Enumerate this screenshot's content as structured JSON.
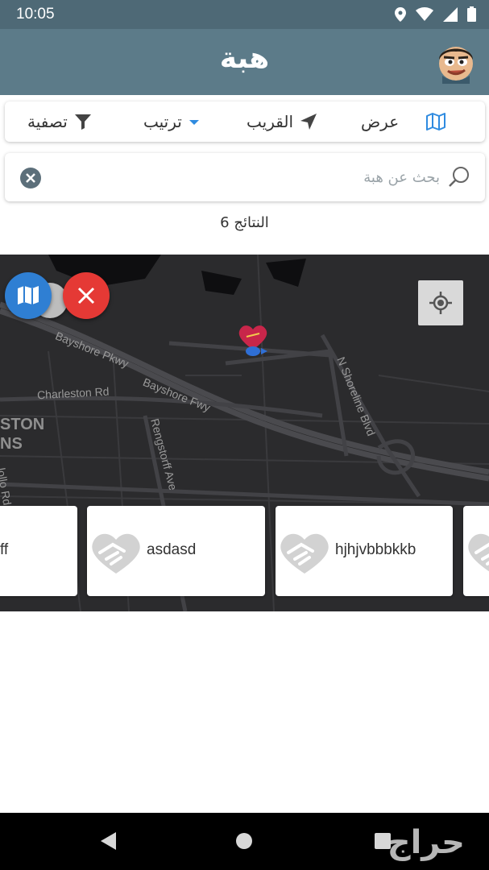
{
  "status_bar": {
    "time": "10:05",
    "icons": [
      "location-icon",
      "wifi-icon",
      "signal-icon",
      "battery-icon"
    ]
  },
  "app_bar": {
    "title": "هبة",
    "avatar": "avatar"
  },
  "toolbar": {
    "map_icon": "map-icon",
    "display_label": "عرض",
    "nearby_label": "القريب",
    "sort_label": "ترتيب",
    "filter_label": "تصفية"
  },
  "search": {
    "placeholder": "بحث عن هبة",
    "value": ""
  },
  "results": {
    "count_text": "النتائج 6"
  },
  "map": {
    "labels": {
      "bayshore_pkwy": "Bayshore Pkwy",
      "bayshore_fwy": "Bayshore Fwy",
      "charleston_rd": "Charleston Rd",
      "rengstorff_ave": "Rengstorff Ave",
      "shoreline_blvd": "N Shoreline Blvd",
      "area_a": "STON",
      "area_b": "NS",
      "road_partial": "lollo Rd"
    },
    "colors": {
      "background": "#2b2b2d",
      "marker": "#c8264a",
      "fab_blue": "#2f7fd3",
      "fab_red": "#e53935"
    }
  },
  "cards": [
    {
      "title": "ff"
    },
    {
      "title": "asdasd"
    },
    {
      "title": "hjhjvbbbkkb"
    },
    {
      "title": ""
    }
  ],
  "nav_bar": {
    "watermark": "حراج"
  }
}
